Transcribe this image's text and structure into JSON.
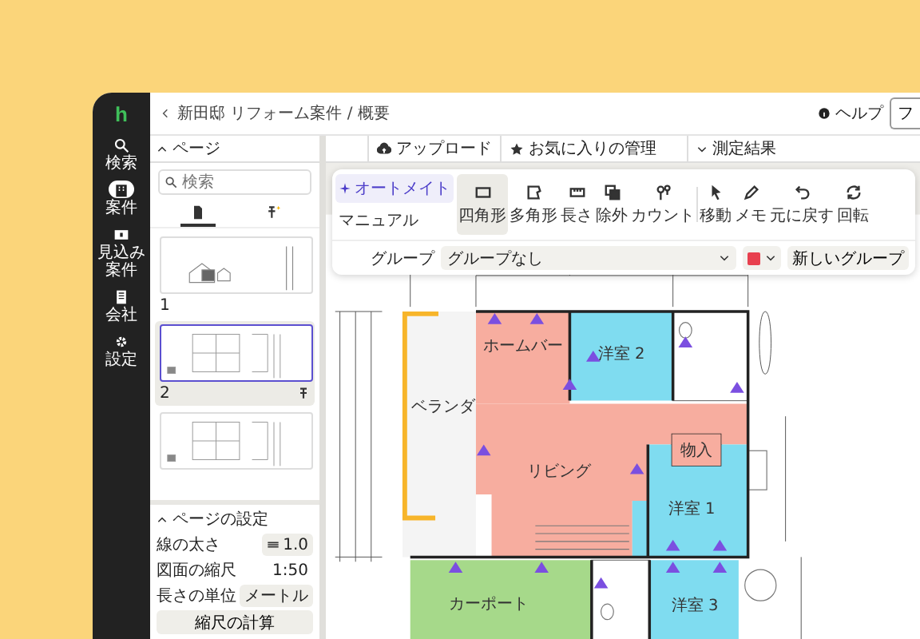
{
  "sidebar": {
    "logo": "h",
    "items": [
      {
        "label": "検索",
        "selected": false
      },
      {
        "label": "案件",
        "selected": true
      },
      {
        "label": "見込み案件",
        "selected": false
      },
      {
        "label": "会社",
        "selected": false
      },
      {
        "label": "設定",
        "selected": false
      }
    ]
  },
  "header": {
    "breadcrumb": "新田邸 リフォーム案件 / 概要",
    "help": "ヘルプ",
    "button": "フ"
  },
  "pages_panel": {
    "title": "ページ",
    "search": {
      "placeholder": "検索"
    },
    "tabs": [
      {
        "selected": true
      },
      {
        "selected": false
      }
    ],
    "pages": [
      {
        "number": "1",
        "selected": false,
        "pinned": false
      },
      {
        "number": "2",
        "selected": true,
        "pinned": true
      },
      {
        "selected": false,
        "pinned": false
      }
    ]
  },
  "page_settings": {
    "title": "ページの設定",
    "rows": [
      {
        "label": "線の太さ",
        "value": "1.0",
        "kind": "line"
      },
      {
        "label": "図面の縮尺",
        "value": "1:50",
        "kind": "plain"
      },
      {
        "label": "長さの単位",
        "value": "メートル",
        "kind": "select"
      }
    ],
    "button": "縮尺の計算"
  },
  "top_bar": {
    "upload": "アップロード",
    "favorites": "お気に入りの管理",
    "results": "測定結果"
  },
  "toolbar": {
    "modes": [
      {
        "label": "オートメイト",
        "selected": true
      },
      {
        "label": "マニュアル",
        "selected": false
      }
    ],
    "tools": [
      {
        "label": "四角形",
        "selected": true
      },
      {
        "label": "多角形",
        "selected": false
      },
      {
        "label": "長さ",
        "selected": false
      },
      {
        "label": "除外",
        "selected": false
      },
      {
        "label": "カウント",
        "selected": false
      },
      {
        "label": "移動",
        "selected": false
      },
      {
        "label": "メモ",
        "selected": false
      },
      {
        "label": "元に戻す",
        "selected": false
      },
      {
        "label": "回転",
        "selected": false
      }
    ],
    "group": {
      "label": "グループ",
      "value": "グループなし",
      "color": "#e8404f",
      "new_button": "新しいグループ"
    }
  },
  "plan": {
    "rooms": [
      {
        "label": "ホームバー",
        "kind": "room",
        "color": "#f7ad9f"
      },
      {
        "label": "洋室 2",
        "kind": "room",
        "color": "#7fdcf0"
      },
      {
        "label": "ベランダ",
        "kind": "balcony",
        "color": "#f4f4f4"
      },
      {
        "label": "物入",
        "kind": "closet",
        "color": "#f7ad9f"
      },
      {
        "label": "リビング",
        "kind": "room",
        "color": "#f7ad9f"
      },
      {
        "label": "洋室 1",
        "kind": "room",
        "color": "#7fdcf0"
      },
      {
        "label": "カーポート",
        "kind": "room",
        "color": "#a6d98a"
      },
      {
        "label": "洋室 3",
        "kind": "room",
        "color": "#7fdcf0"
      }
    ]
  }
}
